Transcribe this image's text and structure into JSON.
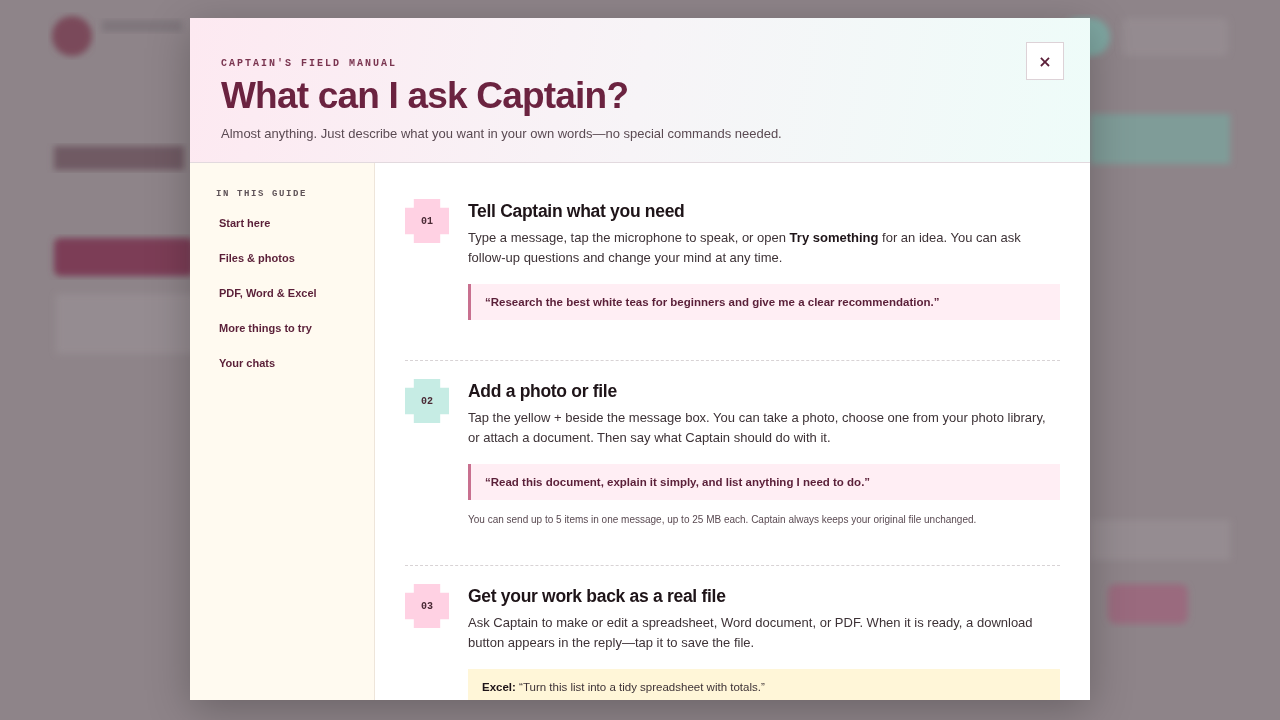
{
  "dialog": {
    "eyebrow": "CAPTAIN'S FIELD MANUAL",
    "title": "What can I ask Captain?",
    "subtitle": "Almost anything. Just describe what you want in your own words—no special commands needed.",
    "close_label": "×"
  },
  "guide": {
    "heading": "IN THIS GUIDE",
    "items": [
      {
        "label": "Start here"
      },
      {
        "label": "Files & photos"
      },
      {
        "label": "PDF, Word & Excel"
      },
      {
        "label": "More things to try"
      },
      {
        "label": "Your chats"
      }
    ]
  },
  "steps": [
    {
      "number": "01",
      "color": "#ffd1e3",
      "title": "Tell Captain what you need",
      "body": "Type a message, tap the microphone to speak, or open **Try something** for an idea. You can ask follow-up questions and change your mind at any time.",
      "example": {
        "kind": "quote",
        "text": "“Research the best white teas for beginners and give me a clear recommendation.”"
      }
    },
    {
      "number": "02",
      "color": "#c6ece4",
      "title": "Add a photo or file",
      "body": "Tap the yellow + beside the message box. You can take a photo, choose one from your photo library, or attach a document. Then say what Captain should do with it.",
      "example": {
        "kind": "quote",
        "text": "“Read this document, explain it simply, and list anything I need to do.”"
      },
      "note": "You can send up to 5 items in one message, up to 25 MB each. Captain always keeps your original file unchanged."
    },
    {
      "number": "03",
      "color": "#ffd1e3",
      "title": "Get your work back as a real file",
      "body": "Ask Captain to make or edit a spreadsheet, Word document, or PDF. When it is ready, a download button appears in the reply—tap it to save the file.",
      "example": {
        "kind": "file",
        "text": "**Excel:** “Turn this list into a tidy spreadsheet with totals.”"
      }
    }
  ]
}
